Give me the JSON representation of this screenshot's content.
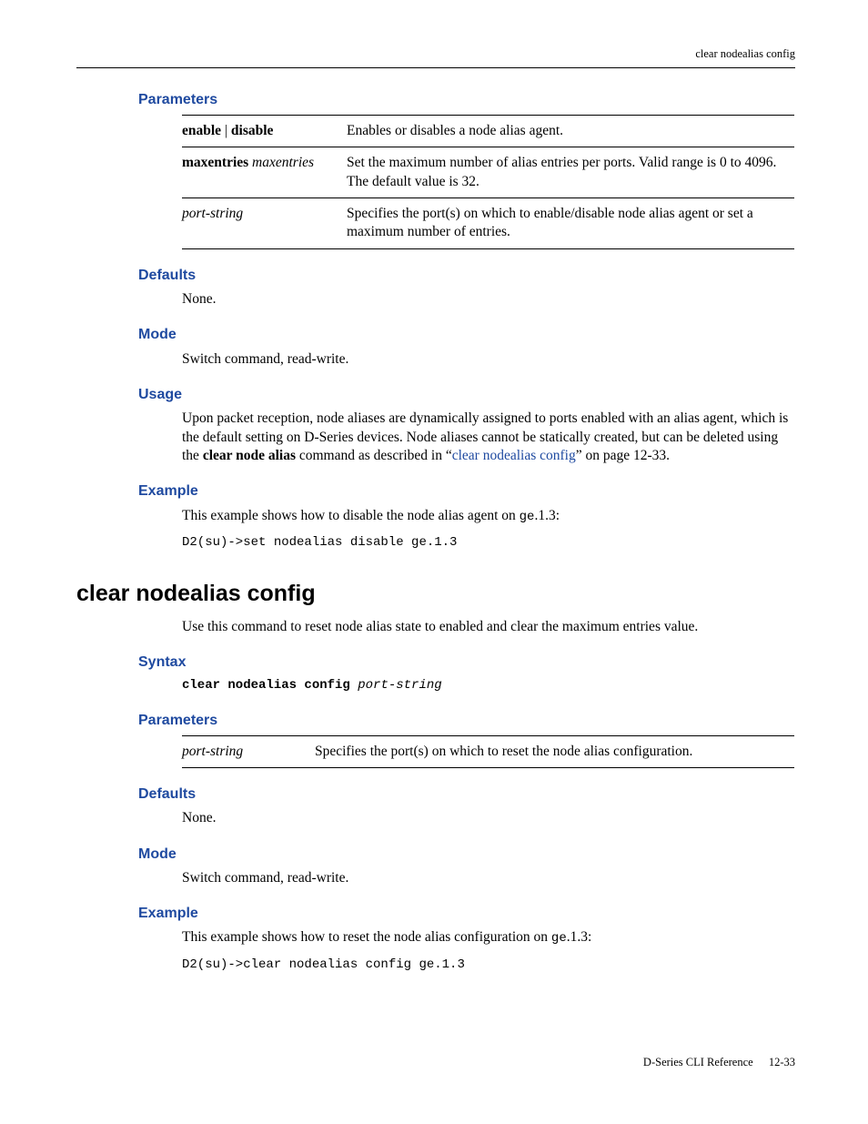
{
  "header": {
    "running_title": "clear nodealias config"
  },
  "s1": {
    "h_parameters": "Parameters",
    "params": [
      {
        "name_parts": [
          {
            "text": "enable",
            "style": "bold"
          },
          {
            "text": " | ",
            "style": "normal"
          },
          {
            "text": "disable",
            "style": "bold"
          }
        ],
        "desc": "Enables or disables a node alias agent."
      },
      {
        "name_parts": [
          {
            "text": "maxentries",
            "style": "bold"
          },
          {
            "text": " maxentries",
            "style": "italic"
          }
        ],
        "desc": "Set the maximum number of alias entries per ports. Valid range is 0 to 4096. The default value is 32."
      },
      {
        "name_parts": [
          {
            "text": "port-string",
            "style": "italic"
          }
        ],
        "desc": "Specifies the port(s) on which to enable/disable node alias agent or set a maximum number of entries."
      }
    ],
    "h_defaults": "Defaults",
    "defaults_body": "None.",
    "h_mode": "Mode",
    "mode_body": "Switch command, read-write.",
    "h_usage": "Usage",
    "usage_pre": "Upon packet reception, node aliases are dynamically assigned to ports enabled with an alias agent, which is the default setting on D-Series devices. Node aliases cannot be statically created, but can be deleted using the ",
    "usage_bold": "clear node alias",
    "usage_mid": " command as described in “",
    "usage_link": "clear nodealias config",
    "usage_post": "” on page 12-33.",
    "h_example": "Example",
    "example_intro_pre": "This example shows how to disable the node alias agent on ",
    "example_intro_code": "ge",
    "example_intro_post": ".1.3:",
    "example_code": "D2(su)->set nodealias disable ge.1.3"
  },
  "s2": {
    "h_main": "clear nodealias config",
    "intro": "Use this command to reset node alias state to enabled and clear the maximum entries value.",
    "h_syntax": "Syntax",
    "syntax_bold": "clear nodealias config",
    "syntax_ital": " port-string",
    "h_parameters": "Parameters",
    "params": [
      {
        "name_parts": [
          {
            "text": "port-string",
            "style": "italic"
          }
        ],
        "desc": "Specifies the port(s) on which to reset the node alias configuration."
      }
    ],
    "h_defaults": "Defaults",
    "defaults_body": "None.",
    "h_mode": "Mode",
    "mode_body": "Switch command, read-write.",
    "h_example": "Example",
    "example_intro_pre": "This example shows how to reset the node alias configuration on ",
    "example_intro_code": "ge",
    "example_intro_post": ".1.3:",
    "example_code": "D2(su)->clear nodealias config ge.1.3"
  },
  "footer": {
    "book": "D-Series CLI Reference",
    "page": "12-33"
  }
}
